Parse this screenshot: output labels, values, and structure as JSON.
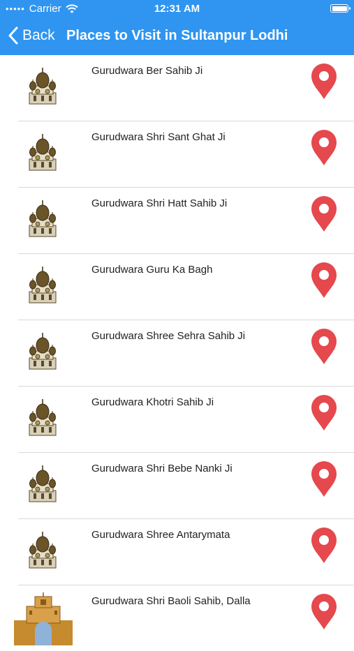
{
  "status": {
    "carrier": "Carrier",
    "time": "12:31 AM",
    "battery_level": 1.0
  },
  "nav": {
    "back_label": "Back",
    "title": "Places to Visit in Sultanpur Lodhi"
  },
  "places": [
    {
      "name": "Gurudwara Ber Sahib Ji"
    },
    {
      "name": "Gurudwara Shri Sant Ghat Ji"
    },
    {
      "name": "Gurudwara Shri Hatt Sahib Ji"
    },
    {
      "name": "Gurudwara Guru Ka Bagh"
    },
    {
      "name": "Gurudwara Shree Sehra Sahib Ji"
    },
    {
      "name": "Gurudwara Khotri Sahib Ji"
    },
    {
      "name": "Gurudwara Shri Bebe Nanki Ji"
    },
    {
      "name": "Gurudwara Shree Antarymata"
    },
    {
      "name": "Gurudwara Shri Baoli Sahib, Dalla"
    }
  ],
  "colors": {
    "accent": "#2f95f0",
    "pin": "#e5484d"
  },
  "icons": {
    "thumbnail": "gurudwara-icon",
    "location": "map-pin-icon"
  }
}
